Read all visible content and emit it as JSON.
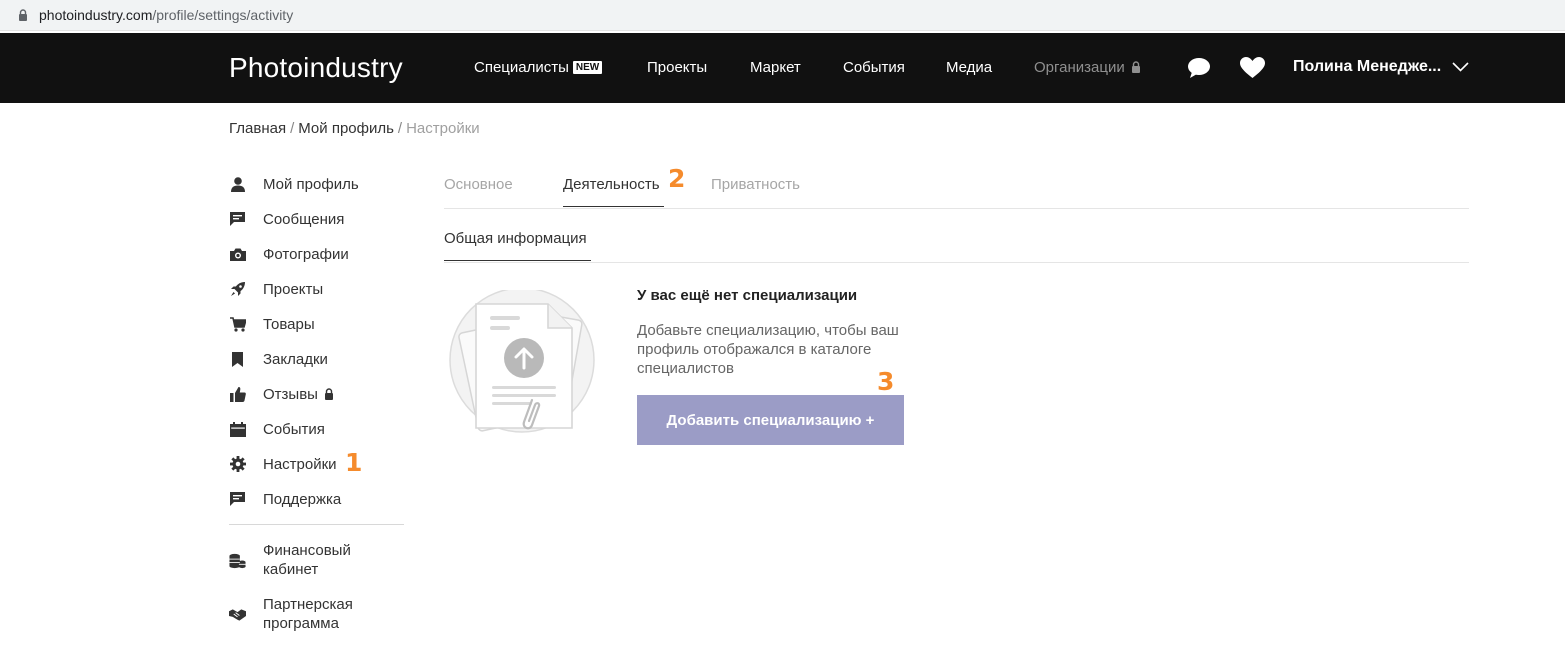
{
  "browser": {
    "url_host": "photoindustry.com",
    "url_path": "/profile/settings/activity"
  },
  "header": {
    "logo": "Photoindustry",
    "nav": [
      {
        "label": "Специалисты",
        "badge": "NEW"
      },
      {
        "label": "Проекты"
      },
      {
        "label": "Маркет"
      },
      {
        "label": "События"
      },
      {
        "label": "Медиа"
      },
      {
        "label": "Организации",
        "locked": true
      }
    ],
    "icons": [
      "chat-icon",
      "heart-icon"
    ],
    "user_name": "Полина Менедже..."
  },
  "breadcrumb": {
    "items": [
      "Главная",
      "Мой профиль"
    ],
    "separator": "/",
    "current": "Настройки"
  },
  "sidebar": {
    "items": [
      {
        "label": "Мой профиль",
        "icon": "user-icon"
      },
      {
        "label": "Сообщения",
        "icon": "message-icon"
      },
      {
        "label": "Фотографии",
        "icon": "camera-icon"
      },
      {
        "label": "Проекты",
        "icon": "rocket-icon"
      },
      {
        "label": "Товары",
        "icon": "cart-icon"
      },
      {
        "label": "Закладки",
        "icon": "bookmark-icon"
      },
      {
        "label": "Отзывы",
        "icon": "thumbs-up-icon",
        "locked": true
      },
      {
        "label": "События",
        "icon": "calendar-icon"
      },
      {
        "label": "Настройки",
        "icon": "gear-icon"
      },
      {
        "label": "Поддержка",
        "icon": "support-icon"
      }
    ],
    "extra": [
      {
        "line1": "Финансовый",
        "line2": "кабинет",
        "icon": "coins-icon"
      },
      {
        "line1": "Партнерская",
        "line2": "программа",
        "icon": "handshake-icon"
      }
    ]
  },
  "markers": [
    "1",
    "2",
    "3"
  ],
  "tabs": {
    "items": [
      "Основное",
      "Деятельность",
      "Приватность"
    ],
    "active": "Деятельность",
    "subtab": "Общая информация"
  },
  "empty_state": {
    "title": "У вас ещё нет специализации",
    "description": "Добавьте специализацию, чтобы ваш профиль отображался в каталоге специалистов",
    "button": "Добавить специализацию +"
  },
  "colors": {
    "header_bg": "#111111",
    "button_bg": "#9b9cc6",
    "marker": "#f58b2c"
  }
}
